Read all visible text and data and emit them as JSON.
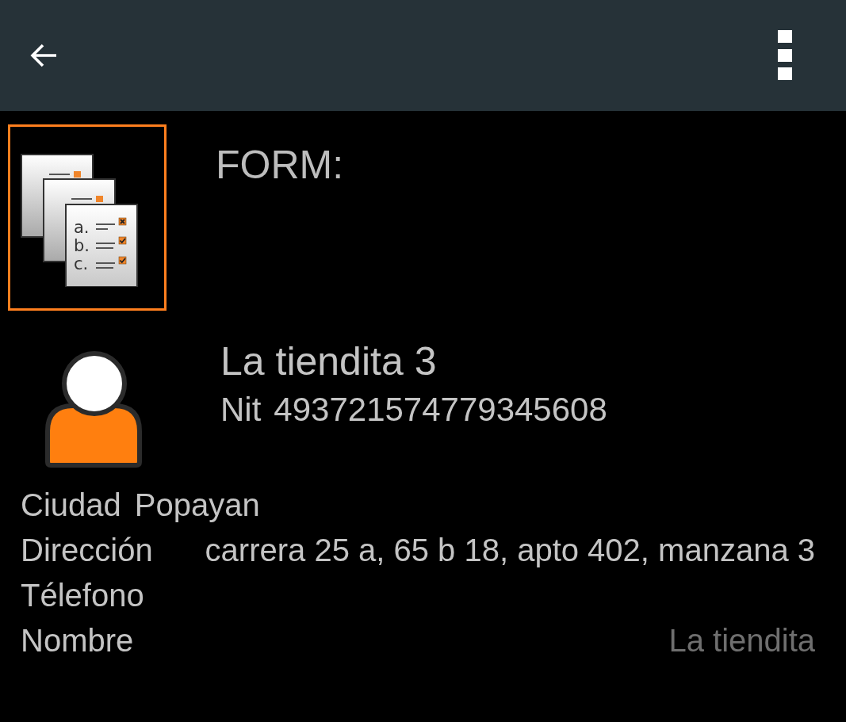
{
  "form_header": {
    "highlighted": true,
    "icon_items": [
      {
        "label": "a.",
        "kind": "cross"
      },
      {
        "label": "b.",
        "kind": "tick"
      },
      {
        "label": "c.",
        "kind": "tick"
      }
    ],
    "title": "FORM:"
  },
  "client": {
    "name": "La tiendita 3",
    "id_label": "Nit",
    "id_value": "493721574779345608"
  },
  "details": [
    {
      "kind": "inline",
      "label": "Ciudad",
      "value": "Popayan"
    },
    {
      "kind": "right",
      "label": "Dirección",
      "value": "carrera 25 a, 65 b 18, apto 402, manzana 3"
    },
    {
      "kind": "right",
      "label": "Télefono"
    },
    {
      "kind": "field",
      "label": "Nombre",
      "placeholder": "La tiendita"
    }
  ]
}
